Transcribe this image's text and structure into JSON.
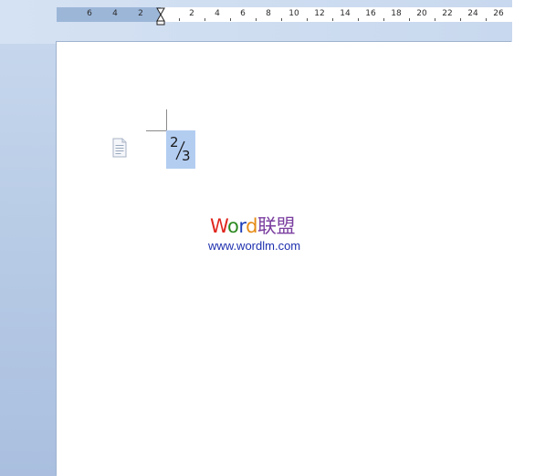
{
  "ruler": {
    "labels": [
      "6",
      "4",
      "2",
      "2",
      "4",
      "6",
      "8",
      "10",
      "12",
      "14",
      "16",
      "18",
      "20",
      "22",
      "24",
      "26"
    ]
  },
  "document": {
    "fraction": {
      "numerator": "2",
      "denominator": "3"
    },
    "watermark": {
      "title_parts": [
        {
          "text": "W",
          "color": "#e0261e"
        },
        {
          "text": "o",
          "color": "#2e8a22"
        },
        {
          "text": "r",
          "color": "#1f3fb8"
        },
        {
          "text": "d",
          "color": "#e58b16"
        },
        {
          "text": "联盟",
          "color": "#7b3fa0"
        }
      ],
      "url": "www.wordlm.com"
    }
  },
  "icons": {
    "indent_marker": "hourglass-indent-icon",
    "document": "document-icon"
  }
}
